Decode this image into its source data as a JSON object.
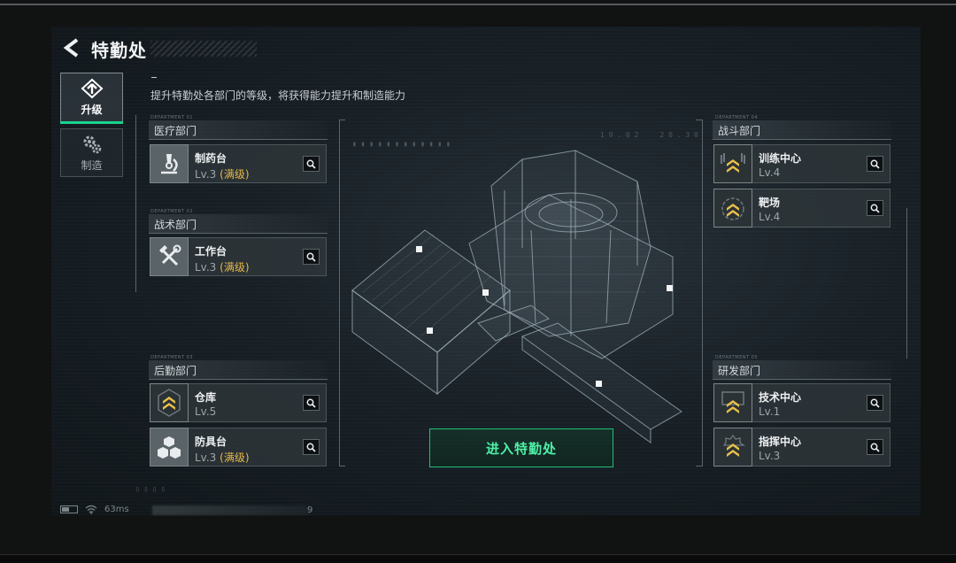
{
  "header": {
    "back_icon": "chevron-left-icon",
    "title": "特勤处",
    "subtitle": "提升特勤处各部门的等级，将获得能力提升和制造能力"
  },
  "tabs": [
    {
      "label": "升级",
      "icon": "upgrade-icon",
      "active": true
    },
    {
      "label": "制造",
      "icon": "gears-icon",
      "active": false
    }
  ],
  "sections": {
    "medical": {
      "title": "医疗部门",
      "tag": "DEPARTMENT 01"
    },
    "tactical": {
      "title": "战术部门",
      "tag": "DEPARTMENT 02"
    },
    "logistics": {
      "title": "后勤部门",
      "tag": "DEPARTMENT 03"
    },
    "combat": {
      "title": "战斗部门",
      "tag": "DEPARTMENT 04"
    },
    "research": {
      "title": "研发部门",
      "tag": "DEPARTMENT 05"
    }
  },
  "cards": {
    "pharmacy": {
      "name": "制药台",
      "level": "Lv.3",
      "max": "(满级)",
      "icon": "microscope-icon"
    },
    "workbench": {
      "name": "工作台",
      "level": "Lv.3",
      "max": "(满级)",
      "icon": "hammer-wrench-icon"
    },
    "warehouse": {
      "name": "仓库",
      "level": "Lv.5",
      "icon": "rank-chevrons-icon"
    },
    "armor": {
      "name": "防具台",
      "level": "Lv.3",
      "max": "(满级)",
      "icon": "cubes-icon"
    },
    "training": {
      "name": "训练中心",
      "level": "Lv.4",
      "icon": "rank-chevrons-icon"
    },
    "range": {
      "name": "靶场",
      "level": "Lv.4",
      "icon": "rank-chevrons-icon"
    },
    "tech": {
      "name": "技术中心",
      "level": "Lv.1",
      "icon": "rank-chevrons-icon"
    },
    "command": {
      "name": "指挥中心",
      "level": "Lv.3",
      "icon": "rank-chevrons-icon"
    }
  },
  "enter_button": "进入特勤处",
  "status": {
    "ping": "63ms",
    "trailing_char": "9"
  },
  "colors": {
    "accent": "#1fbf7a",
    "max_level": "#e6b84a",
    "rank_gold": "#e8c04a"
  }
}
